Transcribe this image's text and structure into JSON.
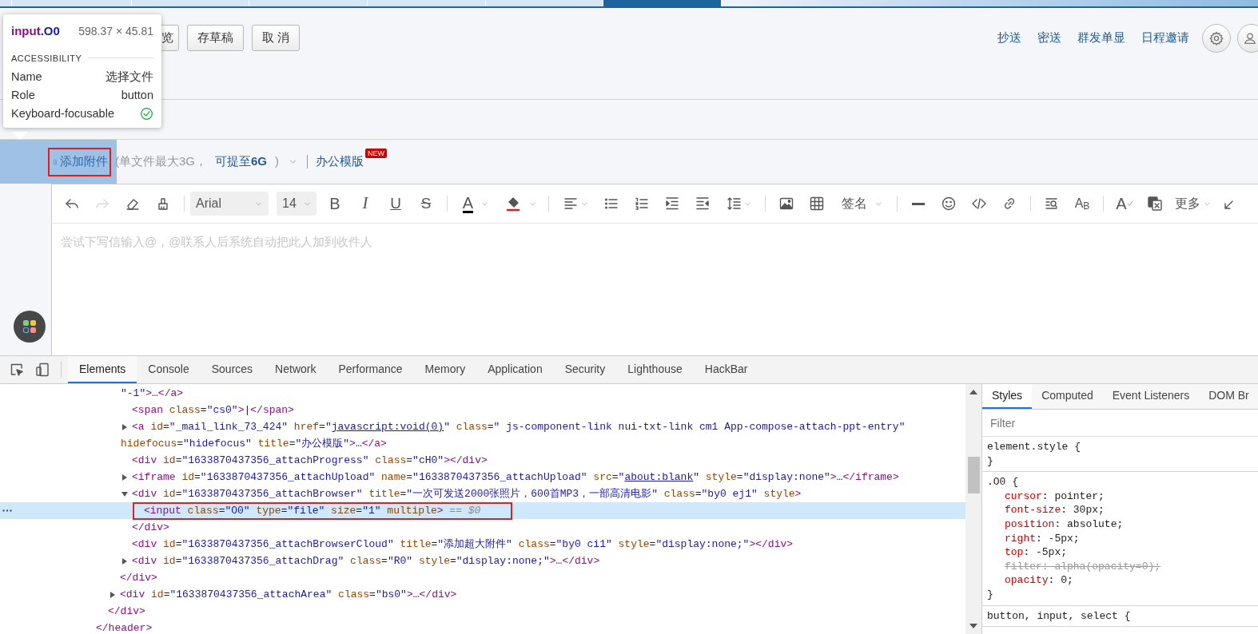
{
  "browser_tabs": [
    {
      "selected": false
    },
    {
      "selected": false
    },
    {
      "selected": false
    },
    {
      "selected": false
    },
    {
      "selected": false
    },
    {
      "selected": false
    },
    {
      "selected": true
    }
  ],
  "compose_actions": [
    "览",
    "存草稿",
    "取 消"
  ],
  "compose_links": [
    "抄送",
    "密送",
    "群发单显",
    "日程邀请"
  ],
  "attachment_bar": {
    "add": "添加附件",
    "limit": "(单文件最大3G，",
    "upgrade": "可提至**6G**",
    "limit_end": ")",
    "template": "办公模版",
    "badge": "NEW"
  },
  "inspect_tooltip": {
    "tag": "input",
    "class": ".O0",
    "size": "598.37 × 45.81",
    "section": "ACCESSIBILITY",
    "rows": [
      {
        "label": "Name",
        "value": "选择文件"
      },
      {
        "label": "Role",
        "value": "button"
      },
      {
        "label": "Keyboard-focusable",
        "focusable": true
      }
    ]
  },
  "editor_toolbar": {
    "redo_disabled": true,
    "font": "Arial",
    "size": "14",
    "bold": "B",
    "italic": "I",
    "underline": "U",
    "strike": "S",
    "font_color": "A",
    "signature": "签名",
    "case": "A$_{B}$",
    "grammar": "A",
    "more": "更多"
  },
  "editor": {
    "placeholder": "尝试下写信输入@，@联系人后系统自动把此人加到收件人"
  },
  "devtools": {
    "tabs": [
      {
        "label": "Elements",
        "selected": true
      },
      {
        "label": "Console",
        "selected": false
      },
      {
        "label": "Sources",
        "selected": false
      },
      {
        "label": "Network",
        "selected": false
      },
      {
        "label": "Performance",
        "selected": false
      },
      {
        "label": "Memory",
        "selected": false
      },
      {
        "label": "Application",
        "selected": false
      },
      {
        "label": "Security",
        "selected": false
      },
      {
        "label": "Lighthouse",
        "selected": false
      },
      {
        "label": "HackBar",
        "selected": false
      }
    ],
    "dom": [
      {
        "selected": false,
        "close": [
          {
            "kind": "tag",
            "text": "</header>"
          }
        ],
        "children": [
          {
            "selected": false,
            "close": [
              {
                "kind": "tag",
                "text": "</div>"
              }
            ],
            "children": [
              {
                "selected": false,
                "close": [
                  {
                    "kind": "tag",
                    "text": "</div>"
                  }
                ],
                "children": [
                  {
                    "selected": false,
                    "open_wrap": [
                      {
                        "kind": "value",
                        "text": "\"-1\""
                      },
                      {
                        "kind": "tag",
                        "text": ">"
                      },
                      {
                        "kind": "text",
                        "text": "…"
                      },
                      {
                        "kind": "tag",
                        "text": "</a>"
                      }
                    ]
                  },
                  {
                    "selected": false,
                    "open": [
                      {
                        "kind": "tag",
                        "text": "<span"
                      },
                      {
                        "kind": "attr",
                        "text": " class"
                      },
                      {
                        "kind": "text",
                        "text": "="
                      },
                      {
                        "kind": "value",
                        "text": "\"cs0\""
                      },
                      {
                        "kind": "tag",
                        "text": ">"
                      },
                      {
                        "kind": "text",
                        "text": "|"
                      },
                      {
                        "kind": "tag",
                        "text": "</span>"
                      }
                    ]
                  },
                  {
                    "selected": false,
                    "expanded": false,
                    "open": [
                      {
                        "kind": "tag",
                        "text": "<a"
                      },
                      {
                        "kind": "attr",
                        "text": " id"
                      },
                      {
                        "kind": "text",
                        "text": "="
                      },
                      {
                        "kind": "value",
                        "text": "\"_mail_link_73_424\""
                      },
                      {
                        "kind": "attr",
                        "text": " href"
                      },
                      {
                        "kind": "text",
                        "text": "="
                      },
                      {
                        "kind": "value",
                        "text": "\""
                      },
                      {
                        "kind": "link",
                        "text": "javascript:void(0)"
                      },
                      {
                        "kind": "value",
                        "text": "\""
                      },
                      {
                        "kind": "attr",
                        "text": " class"
                      },
                      {
                        "kind": "text",
                        "text": "="
                      },
                      {
                        "kind": "value",
                        "text": "\" js-component-link nui-txt-link cm1 App-compose-attach-ppt-entry\""
                      }
                    ],
                    "open_wrap": [
                      {
                        "kind": "attr",
                        "text": "hidefocus"
                      },
                      {
                        "kind": "text",
                        "text": "="
                      },
                      {
                        "kind": "value",
                        "text": "\"hidefocus\""
                      },
                      {
                        "kind": "attr",
                        "text": " title"
                      },
                      {
                        "kind": "text",
                        "text": "="
                      },
                      {
                        "kind": "value",
                        "text": "\"办公模版\""
                      },
                      {
                        "kind": "tag",
                        "text": ">"
                      },
                      {
                        "kind": "text",
                        "text": "…"
                      },
                      {
                        "kind": "tag",
                        "text": "</a>"
                      }
                    ]
                  },
                  {
                    "selected": false,
                    "open": [
                      {
                        "kind": "tag",
                        "text": "<div"
                      },
                      {
                        "kind": "attr",
                        "text": " id"
                      },
                      {
                        "kind": "text",
                        "text": "="
                      },
                      {
                        "kind": "value",
                        "text": "\"1633870437356_attachProgress\""
                      },
                      {
                        "kind": "attr",
                        "text": " class"
                      },
                      {
                        "kind": "text",
                        "text": "="
                      },
                      {
                        "kind": "value",
                        "text": "\"cH0\""
                      },
                      {
                        "kind": "tag",
                        "text": "></div>"
                      }
                    ]
                  },
                  {
                    "selected": false,
                    "expanded": false,
                    "open": [
                      {
                        "kind": "tag",
                        "text": "<iframe"
                      },
                      {
                        "kind": "attr",
                        "text": " id"
                      },
                      {
                        "kind": "text",
                        "text": "="
                      },
                      {
                        "kind": "value",
                        "text": "\"1633870437356_attachUpload\""
                      },
                      {
                        "kind": "attr",
                        "text": " name"
                      },
                      {
                        "kind": "text",
                        "text": "="
                      },
                      {
                        "kind": "value",
                        "text": "\"1633870437356_attachUpload\""
                      },
                      {
                        "kind": "attr",
                        "text": " src"
                      },
                      {
                        "kind": "text",
                        "text": "="
                      },
                      {
                        "kind": "value",
                        "text": "\""
                      },
                      {
                        "kind": "link",
                        "text": "about:blank"
                      },
                      {
                        "kind": "value",
                        "text": "\""
                      },
                      {
                        "kind": "attr",
                        "text": " style"
                      },
                      {
                        "kind": "text",
                        "text": "="
                      },
                      {
                        "kind": "value",
                        "text": "\"display:none\""
                      },
                      {
                        "kind": "tag",
                        "text": ">"
                      },
                      {
                        "kind": "text",
                        "text": "…"
                      },
                      {
                        "kind": "tag",
                        "text": "</iframe>"
                      }
                    ]
                  },
                  {
                    "selected": false,
                    "expanded": true,
                    "open": [
                      {
                        "kind": "tag",
                        "text": "<div"
                      },
                      {
                        "kind": "attr",
                        "text": " id"
                      },
                      {
                        "kind": "text",
                        "text": "="
                      },
                      {
                        "kind": "value",
                        "text": "\"1633870437356_attachBrowser\""
                      },
                      {
                        "kind": "attr",
                        "text": " title"
                      },
                      {
                        "kind": "text",
                        "text": "="
                      },
                      {
                        "kind": "value",
                        "text": "\"一次可发送2000张照片，600首MP3，一部高清电影\""
                      },
                      {
                        "kind": "attr",
                        "text": " class"
                      },
                      {
                        "kind": "text",
                        "text": "="
                      },
                      {
                        "kind": "value",
                        "text": "\"by0 ej1\""
                      },
                      {
                        "kind": "attr",
                        "text": " style"
                      },
                      {
                        "kind": "tag",
                        "text": ">"
                      }
                    ],
                    "children": [
                      {
                        "selected": true,
                        "open": [
                          {
                            "kind": "tag",
                            "text": "<input"
                          },
                          {
                            "kind": "attr",
                            "text": " class"
                          },
                          {
                            "kind": "text",
                            "text": "="
                          },
                          {
                            "kind": "value",
                            "text": "\"O0\""
                          },
                          {
                            "kind": "attr",
                            "text": " type"
                          },
                          {
                            "kind": "text",
                            "text": "="
                          },
                          {
                            "kind": "value",
                            "text": "\"file\""
                          },
                          {
                            "kind": "attr",
                            "text": " size"
                          },
                          {
                            "kind": "text",
                            "text": "="
                          },
                          {
                            "kind": "value",
                            "text": "\"1\""
                          },
                          {
                            "kind": "attr",
                            "text": " multiple"
                          },
                          {
                            "kind": "tag",
                            "text": ">"
                          },
                          {
                            "kind": "hint",
                            "text": " == $0"
                          }
                        ]
                      }
                    ],
                    "close": [
                      {
                        "kind": "tag",
                        "text": "</div>"
                      }
                    ]
                  },
                  {
                    "selected": false,
                    "open": [
                      {
                        "kind": "tag",
                        "text": "<div"
                      },
                      {
                        "kind": "attr",
                        "text": " id"
                      },
                      {
                        "kind": "text",
                        "text": "="
                      },
                      {
                        "kind": "value",
                        "text": "\"1633870437356_attachBrowserCloud\""
                      },
                      {
                        "kind": "attr",
                        "text": " title"
                      },
                      {
                        "kind": "text",
                        "text": "="
                      },
                      {
                        "kind": "value",
                        "text": "\"添加超大附件\""
                      },
                      {
                        "kind": "attr",
                        "text": " class"
                      },
                      {
                        "kind": "text",
                        "text": "="
                      },
                      {
                        "kind": "value",
                        "text": "\"by0 ci1\""
                      },
                      {
                        "kind": "attr",
                        "text": " style"
                      },
                      {
                        "kind": "text",
                        "text": "="
                      },
                      {
                        "kind": "value",
                        "text": "\"display:none;\""
                      },
                      {
                        "kind": "tag",
                        "text": "></div>"
                      }
                    ]
                  },
                  {
                    "selected": false,
                    "expanded": false,
                    "open": [
                      {
                        "kind": "tag",
                        "text": "<div"
                      },
                      {
                        "kind": "attr",
                        "text": " id"
                      },
                      {
                        "kind": "text",
                        "text": "="
                      },
                      {
                        "kind": "value",
                        "text": "\"1633870437356_attachDrag\""
                      },
                      {
                        "kind": "attr",
                        "text": " class"
                      },
                      {
                        "kind": "text",
                        "text": "="
                      },
                      {
                        "kind": "value",
                        "text": "\"R0\""
                      },
                      {
                        "kind": "attr",
                        "text": " style"
                      },
                      {
                        "kind": "text",
                        "text": "="
                      },
                      {
                        "kind": "value",
                        "text": "\"display:none;\""
                      },
                      {
                        "kind": "tag",
                        "text": ">"
                      },
                      {
                        "kind": "text",
                        "text": "…"
                      },
                      {
                        "kind": "tag",
                        "text": "</div>"
                      }
                    ]
                  }
                ]
              },
              {
                "selected": false,
                "expanded": false,
                "open": [
                  {
                    "kind": "tag",
                    "text": "<div"
                  },
                  {
                    "kind": "attr",
                    "text": " id"
                  },
                  {
                    "kind": "text",
                    "text": "="
                  },
                  {
                    "kind": "value",
                    "text": "\"1633870437356_attachArea\""
                  },
                  {
                    "kind": "attr",
                    "text": " class"
                  },
                  {
                    "kind": "text",
                    "text": "="
                  },
                  {
                    "kind": "value",
                    "text": "\"bs0\""
                  },
                  {
                    "kind": "tag",
                    "text": ">"
                  },
                  {
                    "kind": "text",
                    "text": "…"
                  },
                  {
                    "kind": "tag",
                    "text": "</div>"
                  }
                ]
              }
            ]
          }
        ]
      }
    ],
    "styles_tabs": [
      {
        "label": "Styles",
        "selected": true
      },
      {
        "label": "Computed",
        "selected": false
      },
      {
        "label": "Event Listeners",
        "selected": false
      },
      {
        "label": "DOM Br",
        "selected": false
      }
    ],
    "filter_placeholder": "Filter",
    "rules": [
      {
        "selector": "element.style {",
        "close": "}"
      },
      {
        "selector": ".O0 {",
        "close": "}",
        "declarations": [
          {
            "property": "cursor",
            "value": ": pointer;",
            "overridden": false
          },
          {
            "property": "font-size",
            "value": ": 30px;",
            "overridden": false
          },
          {
            "property": "position",
            "value": ": absolute;",
            "overridden": false
          },
          {
            "property": "right",
            "value": ": -5px;",
            "overridden": false
          },
          {
            "property": "top",
            "value": ": -5px;",
            "overridden": false
          },
          {
            "property": "filter",
            "value": ": alpha(opacity=0);",
            "overridden": true
          },
          {
            "property": "opacity",
            "value": ": 0;",
            "overridden": false
          }
        ]
      },
      {
        "selector": "button, input, select {"
      }
    ]
  }
}
